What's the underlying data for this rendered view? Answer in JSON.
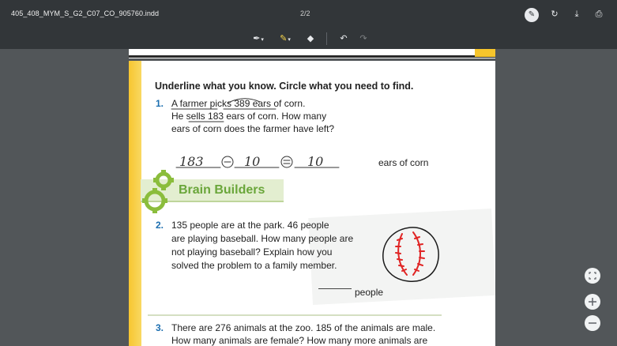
{
  "viewer": {
    "file_name": "405_408_MYM_S_G2_C07_CO_905760.indd",
    "page_counter": "2/2",
    "actions": {
      "annotate_icon": "pen-icon",
      "rotate_icon": "rotate-icon",
      "download_icon": "download-icon",
      "print_icon": "print-icon"
    }
  },
  "annotation_toolbar": {
    "pen_icon": "pen-icon",
    "highlighter_icon": "highlighter-icon",
    "eraser_icon": "eraser-icon",
    "undo_icon": "undo-icon",
    "redo_icon": "redo-icon"
  },
  "zoom_controls": {
    "fit_icon": "fit-page-icon",
    "zoom_in_icon": "zoom-in-icon",
    "zoom_out_icon": "zoom-out-icon"
  },
  "worksheet": {
    "instruction": "Underline what you know. Circle what you need to find.",
    "q1": {
      "number": "1.",
      "lines": [
        "A farmer picks 389 ears of corn.",
        "He sells 183 ears of corn. How many",
        "ears of corn does the farmer have left?"
      ],
      "answer_unit": "ears of corn",
      "handwritten": [
        "183",
        "–",
        "10",
        "=",
        "10"
      ]
    },
    "banner": "Brain Builders",
    "q2": {
      "number": "2.",
      "lines": [
        "135 people are at the park. 46 people",
        "are playing baseball. How many people are",
        "not playing baseball? Explain how you",
        "solved the problem to a family member."
      ],
      "answer_unit": "people"
    },
    "q3": {
      "number": "3.",
      "lines": [
        "There are 276 animals at the zoo. 185 of the animals are male.",
        "How many animals are female? How many more animals are"
      ]
    }
  },
  "colors": {
    "viewer_background": "#525659",
    "toolbar": "#323639",
    "question_number": "#1d6fb0",
    "banner_green": "#6aa63a",
    "page_edge_yellow": "#f7c630",
    "baseball_stitch": "#e02424"
  }
}
